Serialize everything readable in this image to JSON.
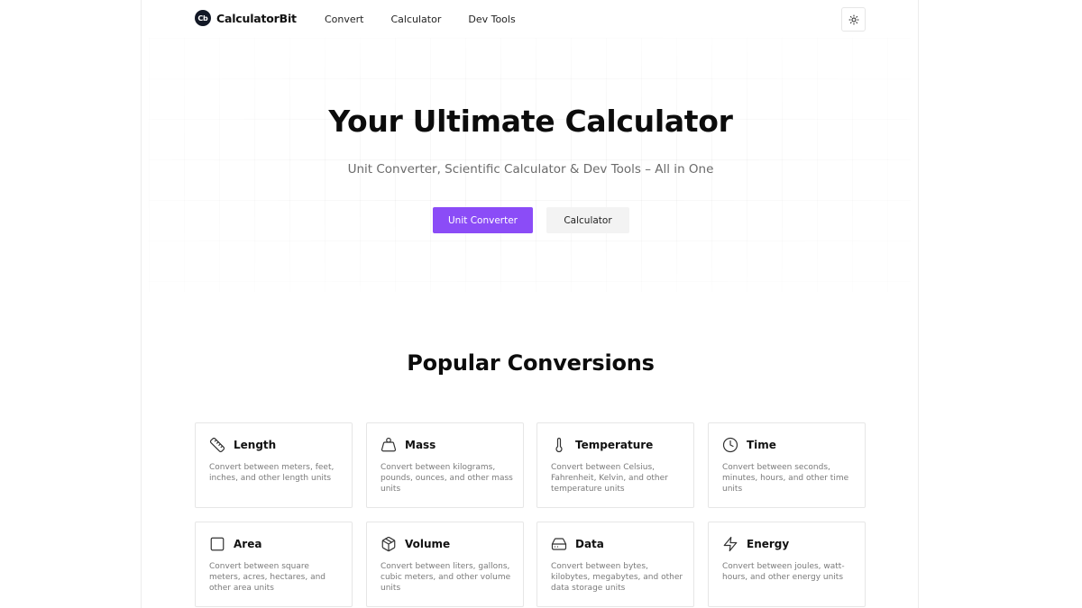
{
  "brand": {
    "logo_text": "Cb",
    "name": "CalculatorBit"
  },
  "nav": {
    "links": [
      "Convert",
      "Calculator",
      "Dev Tools"
    ]
  },
  "hero": {
    "title": "Your Ultimate Calculator",
    "subtitle": "Unit Converter, Scientific Calculator & Dev Tools – All in One",
    "primary_button": "Unit Converter",
    "secondary_button": "Calculator"
  },
  "section": {
    "title": "Popular Conversions"
  },
  "cards": [
    {
      "title": "Length",
      "description": "Convert between meters, feet, inches, and other length units",
      "icon": "ruler-icon"
    },
    {
      "title": "Mass",
      "description": "Convert between kilograms, pounds, ounces, and other mass units",
      "icon": "weight-icon"
    },
    {
      "title": "Temperature",
      "description": "Convert between Celsius, Fahrenheit, Kelvin, and other temperature units",
      "icon": "thermometer-icon"
    },
    {
      "title": "Time",
      "description": "Convert between seconds, minutes, hours, and other time units",
      "icon": "clock-icon"
    },
    {
      "title": "Area",
      "description": "Convert between square meters, acres, hectares, and other area units",
      "icon": "square-icon"
    },
    {
      "title": "Volume",
      "description": "Convert between liters, gallons, cubic meters, and other volume units",
      "icon": "cube-icon"
    },
    {
      "title": "Data",
      "description": "Convert between bytes, kilobytes, megabytes, and other data storage units",
      "icon": "hard-drive-icon"
    },
    {
      "title": "Energy",
      "description": "Convert between joules, watt-hours, and other energy units",
      "icon": "lightning-icon"
    }
  ],
  "colors": {
    "accent": "#8b4cf7",
    "logo_bg": "#121826",
    "secondary_button_bg": "#f3f3f3",
    "text_muted": "#7a7a7a"
  }
}
